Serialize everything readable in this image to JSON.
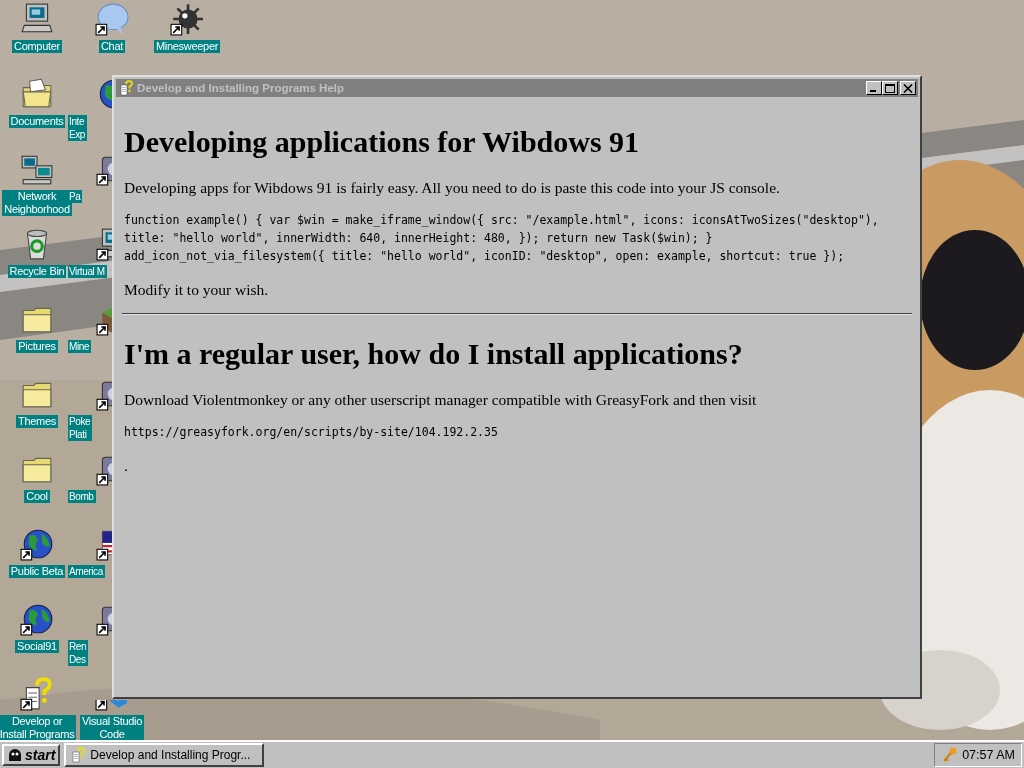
{
  "desktop": {
    "wallpaper": {
      "kind": "picture"
    },
    "icon_columns": [
      [
        {
          "label": "Computer",
          "kind": "computer",
          "shortcut": false
        },
        {
          "label": "Documents",
          "kind": "documents",
          "shortcut": false
        },
        {
          "label": "Network\nNeighborhood",
          "kind": "network",
          "shortcut": false
        },
        {
          "label": "Recycle Bin",
          "kind": "recycle",
          "shortcut": false
        },
        {
          "label": "Pictures",
          "kind": "folder",
          "shortcut": false
        },
        {
          "label": "Themes",
          "kind": "folder",
          "shortcut": false
        },
        {
          "label": "Cool",
          "kind": "folder",
          "shortcut": false
        },
        {
          "label": "Public Beta",
          "kind": "globe",
          "shortcut": true
        },
        {
          "label": "Social91",
          "kind": "globe",
          "shortcut": true
        },
        {
          "label": "Develop or\nInstall Programs",
          "kind": "help",
          "shortcut": true
        }
      ],
      [
        {
          "label": "Chat",
          "kind": "chat",
          "shortcut": true
        },
        {
          "label": "Inte\nExp",
          "kind": "globe",
          "shortcut": false
        },
        {
          "label": "Pa",
          "kind": "generic",
          "shortcut": true
        },
        {
          "label": "Virtual M",
          "kind": "computer",
          "shortcut": true
        },
        {
          "label": "Mine",
          "kind": "block",
          "shortcut": true
        },
        {
          "label": "Poke\nPlati",
          "kind": "generic",
          "shortcut": true
        },
        {
          "label": "Bomb",
          "kind": "generic",
          "shortcut": true
        },
        {
          "label": "America",
          "kind": "flag",
          "shortcut": true
        },
        {
          "label": "Ren\nDes",
          "kind": "generic",
          "shortcut": true
        },
        {
          "label": "Visual Studio\nCode",
          "kind": "vscode",
          "shortcut": true
        }
      ],
      [
        {
          "label": "Minesweeper",
          "kind": "mine",
          "shortcut": true
        }
      ]
    ]
  },
  "window": {
    "title": "Develop and Installing Programs Help",
    "active": false,
    "content": [
      {
        "kind": "heading",
        "text": "Developing applications for Wibdows 91"
      },
      {
        "kind": "paragraph",
        "text": "Developing apps for Wibdows 91 is fairly easy. All you need to do is paste this code into your JS console."
      },
      {
        "kind": "code",
        "lines": [
          "function example() { var $win = make_iframe_window({ src: \"/example.html\", icons: iconsAtTwoSizes(\"desktop\"), title: \"hello world\", innerWidth: 640, innerHeight: 480, }); return new Task($win); }",
          "add_icon_not_via_filesystem({ title: \"hello world\", iconID: \"desktop\", open: example, shortcut: true });"
        ]
      },
      {
        "kind": "paragraph",
        "text": "Modify it to your wish."
      },
      {
        "kind": "rule"
      },
      {
        "kind": "heading",
        "text": "I'm a regular user, how do I install applications?"
      },
      {
        "kind": "paragraph",
        "text": "Download Violentmonkey or any other userscript manager compatible with GreasyFork and then visit"
      },
      {
        "kind": "code",
        "lines": [
          "https://greasyfork.org/en/scripts/by-site/104.192.2.35"
        ]
      },
      {
        "kind": "paragraph",
        "text": "."
      }
    ]
  },
  "taskbar": {
    "start": "start",
    "tasks": [
      {
        "label": "Develop and Installing Progr...",
        "selected": false
      }
    ],
    "clock": "07:57 AM"
  }
}
